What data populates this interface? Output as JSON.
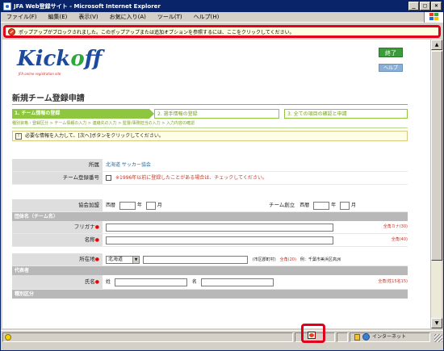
{
  "window": {
    "title": "JFA Web登録サイト - Microsoft Internet Explorer",
    "controls": {
      "minimize": "_",
      "maximize": "□",
      "close": "×"
    }
  },
  "menubar": {
    "items": [
      "ファイル(F)",
      "編集(E)",
      "表示(V)",
      "お気に入り(A)",
      "ツール(T)",
      "ヘルプ(H)"
    ]
  },
  "infobar": {
    "text": "ポップアップがブロックされました。このポップアップまたは追加オプションを参照するには、ここをクリックしてください。"
  },
  "header": {
    "logo_main": "Kick",
    "logo_o": "o",
    "logo_end": "ff",
    "logo_sub": "JFA online registration site",
    "end_button": "終了",
    "help_button": "ヘルプ"
  },
  "page": {
    "title": "新規チーム登録申請",
    "steps": [
      "1. チーム情報の登録",
      "2. 選手情報の登録",
      "3. 全ての項目の確認と申請"
    ],
    "subpath": "種別資格・登録区分 > チーム情報の入力 > 連絡先の入力 > 監督/事務担当の入力 > 入力内容の確認",
    "instruction_icon": "!",
    "instruction": "必要な情報を入力して、[次へ]ボタンをクリックしてください。"
  },
  "form": {
    "affiliation_label": "所属",
    "affiliation_value": "北海道 サッカー協会",
    "team_reg_no_label": "チーム登録番号",
    "team_reg_no_hint": "※1996年以前に登録したことがある場合は、チェックしてください。",
    "founding_label": "協会加盟",
    "era_label": "西暦",
    "year_label": "年",
    "month_label": "月",
    "team_founded_label": "チーム創立",
    "section_team_name": "団体名（チーム名）",
    "furigana_label": "フリガナ",
    "furigana_hint": "全角カナ(30)",
    "name_label": "名称",
    "name_hint": "全角(40)",
    "address_label": "所在地",
    "prefecture_value": "北海道",
    "address_hint": "(市区郡町村)",
    "address_hint2": "全角(20)",
    "address_example": "例：千葉市美浜区高洲",
    "section_representative": "代表者",
    "rep_name_label": "氏名",
    "rep_last_label": "姓",
    "rep_first_label": "名",
    "rep_hint": "全角(姓15名15)",
    "section_category": "種別区分"
  },
  "statusbar": {
    "zone": "インターネット"
  },
  "colors": {
    "highlight_red": "#e1001c",
    "step_green": "#8dc63f",
    "logo_blue": "#1d4a9c",
    "titlebar": "#0a246a"
  }
}
